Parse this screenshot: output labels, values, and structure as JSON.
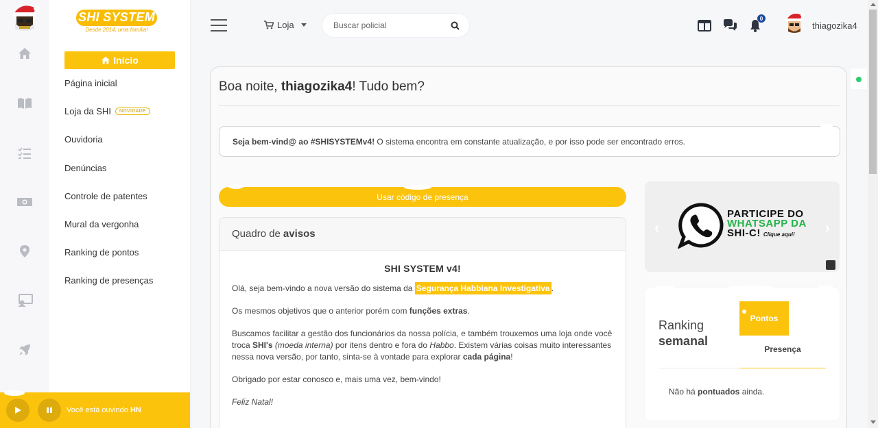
{
  "brand": {
    "logo_title": "SHI SYSTEM",
    "logo_subtitle": "Desde 2014, uma família!",
    "accent": "#fcc30d"
  },
  "rail": {
    "icons": [
      "home-icon",
      "book-icon",
      "list-check-icon",
      "money-icon",
      "map-marker-icon",
      "id-card-icon",
      "rocket-icon"
    ]
  },
  "sidebar": {
    "active_button": "Início",
    "items": [
      {
        "label": "Página inicial"
      },
      {
        "label": "Loja da SHI",
        "badge": "NOVIDADE"
      },
      {
        "label": "Ouvidoria"
      },
      {
        "label": "Denúncias"
      },
      {
        "label": "Controle de patentes"
      },
      {
        "label": "Mural da vergonha"
      },
      {
        "label": "Ranking de pontos"
      },
      {
        "label": "Ranking de presenças"
      }
    ]
  },
  "player": {
    "prefix": "Você está ouvindo",
    "station": "HN"
  },
  "topbar": {
    "shop_label": "Loja",
    "search_placeholder": "Buscar policial",
    "notification_count": "0",
    "username": "thiagozika4"
  },
  "main": {
    "greeting_prefix": "Boa noite, ",
    "greeting_user": "thiagozika4",
    "greeting_suffix": "! Tudo bem?",
    "welcome_bold": "Seja bem-vind@ ao #SHISYSTEMv4!",
    "welcome_text": " O sistema encontra em constante atualização, e por isso pode ser encontrado erros.",
    "presence_button": "Usar código de presença",
    "notices": {
      "title_prefix": "Quadro de",
      "title_bold": "avisos",
      "version_title": "SHI SYSTEM v4!",
      "p1_text": "Olá, seja bem-vindo a nova versão do sistema da ",
      "p1_highlight": "Segurança Habbiana Investigativa",
      "p1_end": ".",
      "p2_text": "Os mesmos objetivos que o anterior porém com ",
      "p2_bold": "funções extras",
      "p2_end": ".",
      "p3_a": "Buscamos facilitar a gestão dos funcionários da nossa polícia, e também trouxemos uma loja onde você troca ",
      "p3_b": "SHI's",
      "p3_c": " (moeda interna)",
      "p3_d": " por itens dentro e fora do ",
      "p3_e": "Habbo",
      "p3_f": ". Existem várias coisas muito interessantes nessa nova versão, por tanto, sinta-se à vontade para explorar ",
      "p3_g": "cada página",
      "p3_h": "!",
      "p4": "Obrigado por estar conosco e, mais uma vez, bem-vindo!",
      "p5": "Feliz Natal!"
    },
    "banner": {
      "line1": "PARTICIPE DO",
      "line2": "WHATSAPP DA",
      "line3": "SHI-C!",
      "cta": "Clique aqui!"
    },
    "ranking": {
      "title_line1": "Ranking",
      "title_line2": "semanal",
      "tab_points": "Pontos",
      "tab_presence": "Presença",
      "empty_prefix": "Não há ",
      "empty_bold": "pontuados",
      "empty_suffix": " ainda."
    }
  }
}
